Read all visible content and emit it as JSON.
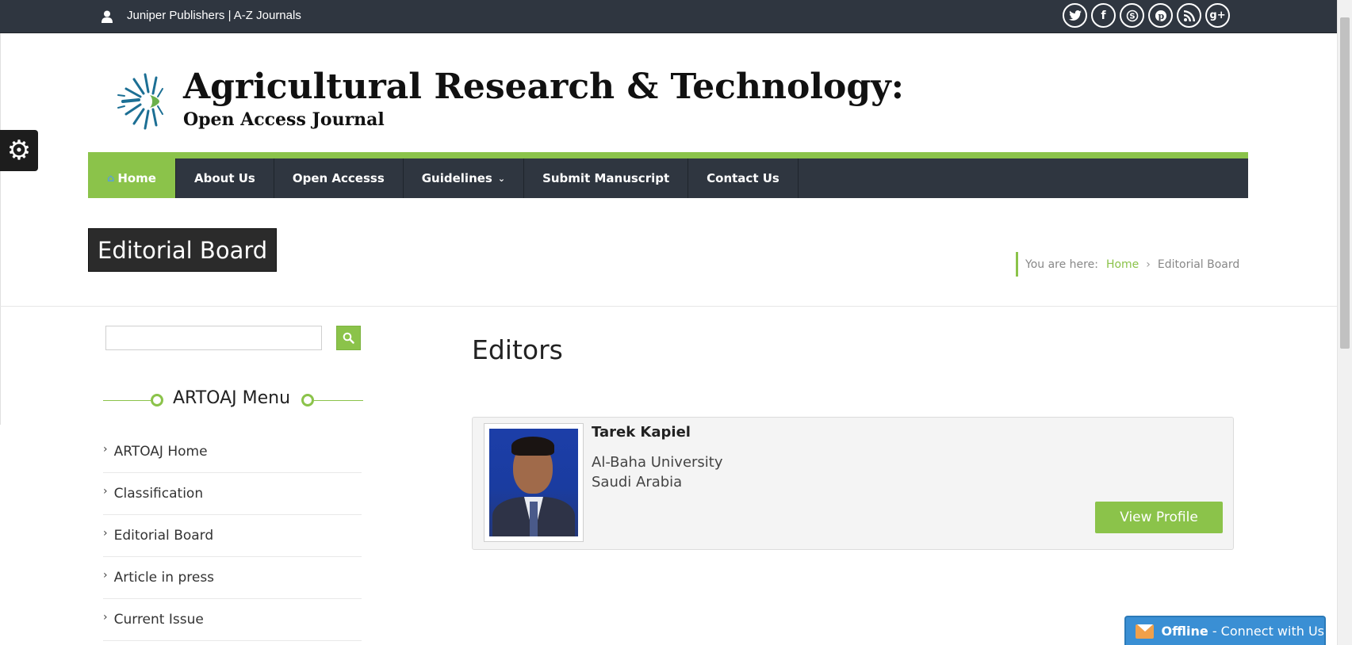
{
  "topbar": {
    "brand": "Juniper Publishers | A-Z Journals",
    "social_icons": [
      "twitter-icon",
      "facebook-icon",
      "skype-icon",
      "pinterest-icon",
      "rss-icon",
      "google-plus-icon"
    ]
  },
  "header": {
    "title": "Agricultural Research & Technology:",
    "subtitle": "Open Access Journal"
  },
  "nav": {
    "items": [
      {
        "label": "Home",
        "active": true
      },
      {
        "label": "About Us"
      },
      {
        "label": "Open Accesss"
      },
      {
        "label": "Guidelines"
      },
      {
        "label": "Submit Manuscript"
      },
      {
        "label": "Contact Us"
      }
    ]
  },
  "page": {
    "title": "Editorial Board"
  },
  "breadcrumb": {
    "prefix": "You are here:",
    "home": "Home",
    "separator": "›",
    "current": "Editorial Board"
  },
  "search": {
    "value": ""
  },
  "sidebar": {
    "heading": "ARTOAJ Menu",
    "items": [
      {
        "label": "ARTOAJ Home"
      },
      {
        "label": "Classification"
      },
      {
        "label": "Editorial Board"
      },
      {
        "label": "Article in press"
      },
      {
        "label": "Current Issue"
      }
    ]
  },
  "main": {
    "section_title": "Editors",
    "editors": [
      {
        "name": "Tarek Kapiel",
        "affiliation": "Al-Baha University",
        "country": "Saudi Arabia",
        "button": "View Profile"
      }
    ]
  },
  "chat": {
    "status": "Offline",
    "label": " - Connect with Us"
  },
  "colors": {
    "accent_green": "#8bc34a",
    "dark_bar": "#2f3640",
    "chat_blue": "#3a8fd4"
  }
}
